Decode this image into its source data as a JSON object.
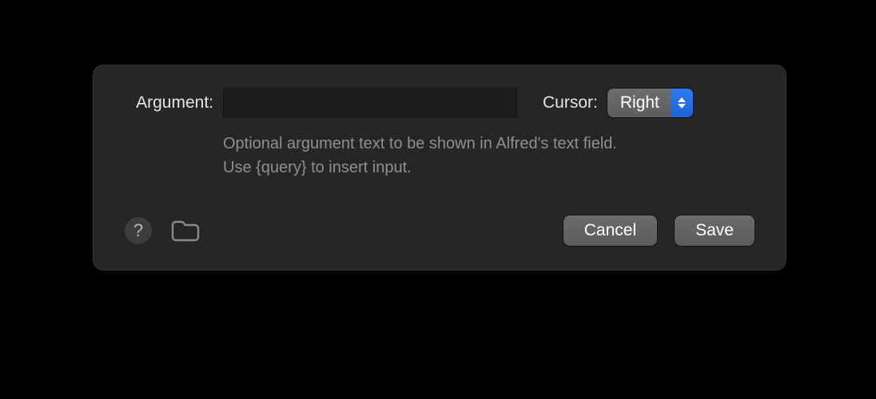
{
  "form": {
    "argument_label": "Argument:",
    "argument_value": "",
    "cursor_label": "Cursor:",
    "cursor_value": "Right",
    "help_line1": "Optional argument text to be shown in Alfred's text field.",
    "help_line2": "Use {query} to insert input."
  },
  "footer": {
    "help_tooltip": "?",
    "cancel_label": "Cancel",
    "save_label": "Save"
  }
}
